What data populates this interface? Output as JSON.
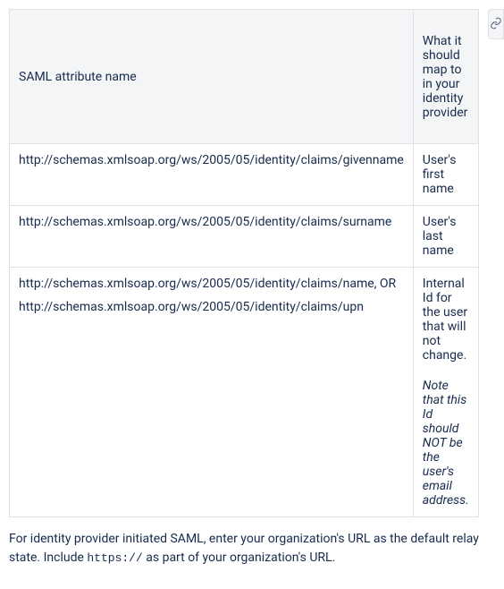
{
  "table": {
    "headers": {
      "col1": "SAML attribute name",
      "col2": "What it should map to in your identity provider"
    },
    "rows": [
      {
        "attr_parts": [
          "http://schemas.xmlsoap.org/ws/2005/05/identity/claims/givenname"
        ],
        "mapping": "User's first name",
        "note": ""
      },
      {
        "attr_parts": [
          "http://schemas.xmlsoap.org/ws/2005/05/identity/claims/surname"
        ],
        "mapping": "User's last name",
        "note": ""
      },
      {
        "attr_parts": [
          "http://schemas.xmlsoap.org/ws/2005/05/identity/claims/name,  OR",
          "http://schemas.xmlsoap.org/ws/2005/05/identity/claims/upn"
        ],
        "mapping": "Internal Id for the user that will not change.",
        "note": "Note that this Id should NOT be the user's email address."
      }
    ]
  },
  "footer": {
    "part1": "For identity provider initiated SAML, enter your organization's URL as the default relay state. Include ",
    "code": "https://",
    "part2": " as part of your organization's URL."
  }
}
